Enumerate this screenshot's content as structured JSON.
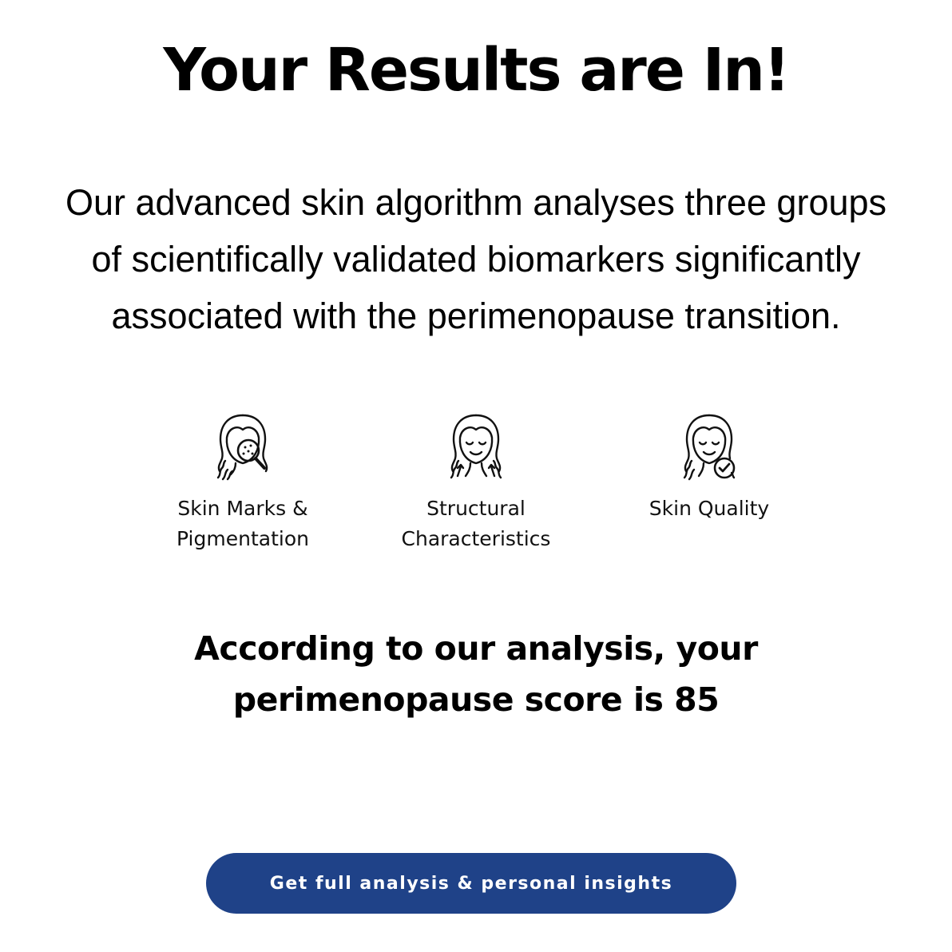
{
  "header": {
    "title": "Your Results are In!"
  },
  "intro": {
    "lines": [
      "Our advanced skin algorithm analyses three groups",
      "of scientifically validated biomarkers significantly",
      "associated with the perimenopause transition."
    ]
  },
  "biomarkers": [
    {
      "icon": "face-magnifier-icon",
      "label_lines": [
        "Skin Marks &",
        "Pigmentation"
      ]
    },
    {
      "icon": "face-lift-arrows-icon",
      "label_lines": [
        "Structural",
        "Characteristics"
      ]
    },
    {
      "icon": "face-checkmark-icon",
      "label_lines": [
        "Skin Quality"
      ]
    }
  ],
  "result": {
    "lines": [
      "According to our analysis, your",
      "perimenopause score is 85"
    ],
    "score": 85
  },
  "cta": {
    "label": "Get full analysis & personal insights",
    "color": "#1f4288"
  }
}
